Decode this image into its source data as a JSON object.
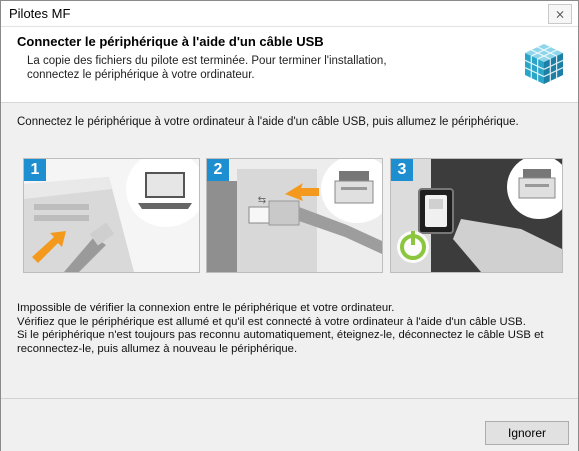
{
  "window": {
    "title": "Pilotes MF",
    "close_glyph": "⨯"
  },
  "header": {
    "title": "Connecter le périphérique à l'aide d'un câble USB",
    "subtitle_line1": "La copie des fichiers du pilote est terminée. Pour terminer l'installation,",
    "subtitle_line2": "connectez le périphérique à votre ordinateur.",
    "icon": "installer-cube-icon"
  },
  "instruction": "Connectez le périphérique à votre ordinateur à l'aide d'un câble USB, puis allumez le périphérique.",
  "steps": [
    {
      "number": "1",
      "icon": "laptop-usb-cable-icon"
    },
    {
      "number": "2",
      "icon": "printer-usb-port-icon"
    },
    {
      "number": "3",
      "icon": "printer-power-button-icon"
    }
  ],
  "message": {
    "line1": "Impossible de vérifier la connexion entre le périphérique et votre ordinateur.",
    "line2": "Vérifiez que le périphérique est allumé et qu'il est connecté à votre ordinateur à l'aide d'un câble USB.",
    "line3": "Si le périphérique n'est toujours pas reconnu automatiquement, éteignez-le, déconnectez le câble USB et reconnectez-le, puis allumez à nouveau le périphérique."
  },
  "footer": {
    "ignore_label": "Ignorer"
  },
  "colors": {
    "step_badge": "#1d8fd1",
    "arrow": "#f39a1e",
    "power_green": "#8cc63f"
  }
}
